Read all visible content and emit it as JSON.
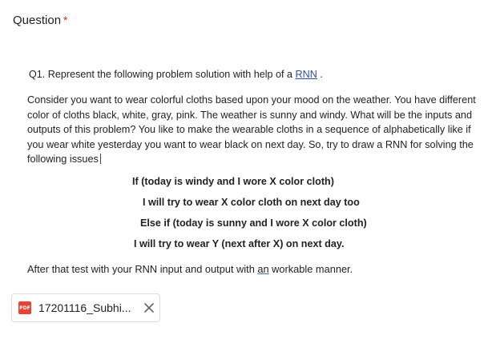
{
  "question": {
    "label": "Question",
    "required_mark": "*"
  },
  "content": {
    "title_prefix": "Q1. Represent the following problem solution with help of a ",
    "title_link": "RNN",
    "title_suffix": " .",
    "paragraph": "Consider you want to wear colorful cloths based upon your mood on the weather. You have different color of cloths black, white, gray, pink. The weather is sunny and windy.  What will be the inputs and outputs of this problem? You like to make the wearable cloths in a sequence of alphabetically like if you wear white yesterday you want to wear black on next day. So, try to draw a RNN for solving the following issues",
    "bold_lines": [
      "If (today is windy and I wore X color cloth)",
      "I will try to wear X color cloth on next day too",
      "Else if (today is sunny and I wore X color cloth)",
      "I will try to wear Y (next after X) on next day."
    ],
    "after_prefix": "After that test with your RNN input and output with ",
    "after_an": "an",
    "after_suffix": " workable manner."
  },
  "attachment": {
    "icon": "pdf-icon",
    "icon_label": "PDF",
    "file_name": "17201116_Subhi...",
    "close_icon": "close-icon"
  }
}
